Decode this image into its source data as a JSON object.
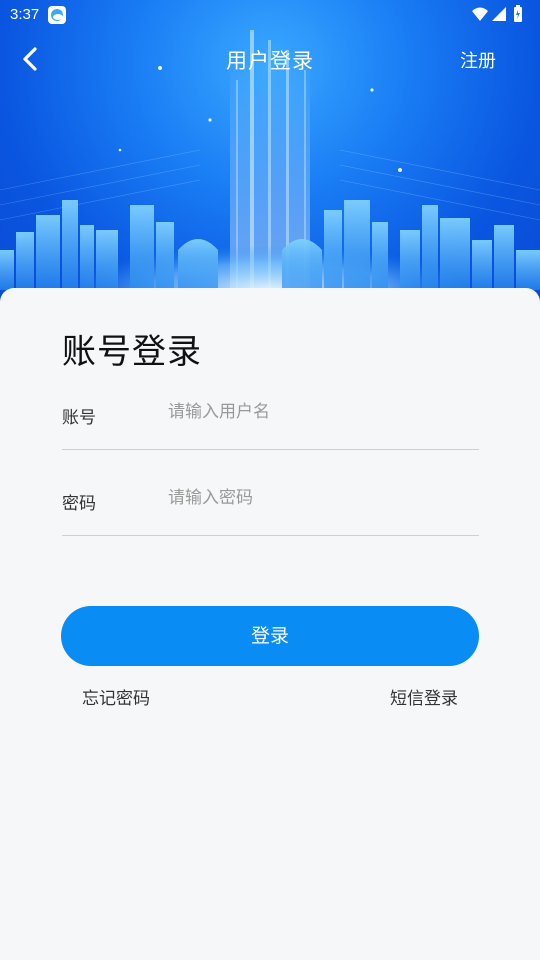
{
  "status_bar": {
    "time": "3:37",
    "icons": [
      "weather-app-icon",
      "wifi-icon",
      "signal-icon",
      "battery-icon"
    ]
  },
  "header": {
    "title": "用户登录",
    "register_label": "注册",
    "back_icon": "chevron-left-icon"
  },
  "login": {
    "heading": "账号登录",
    "account": {
      "label": "账号",
      "placeholder": "请输入用户名",
      "value": ""
    },
    "password": {
      "label": "密码",
      "placeholder": "请输入密码",
      "value": ""
    },
    "submit_label": "登录",
    "forgot_label": "忘记密码",
    "sms_label": "短信登录"
  },
  "colors": {
    "hero_top": "#3aa8ff",
    "hero_bottom": "#0a49d4",
    "primary_button": "#0a8cf5",
    "card_bg": "#f6f7f8",
    "divider": "#cfcfcf"
  }
}
